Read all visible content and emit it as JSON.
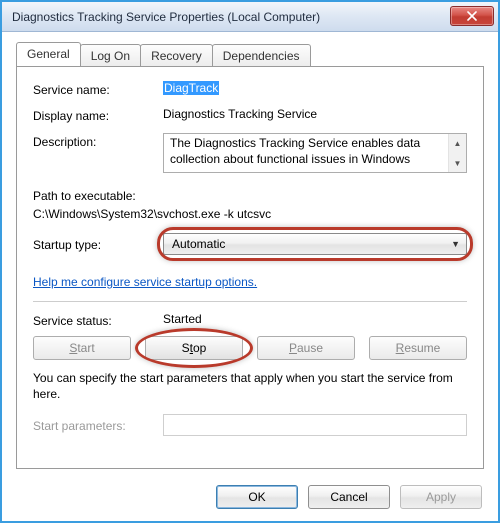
{
  "window": {
    "title": "Diagnostics Tracking Service Properties (Local Computer)"
  },
  "tabs": {
    "general": "General",
    "logon": "Log On",
    "recovery": "Recovery",
    "dependencies": "Dependencies"
  },
  "labels": {
    "service_name": "Service name:",
    "display_name": "Display name:",
    "description": "Description:",
    "path_label": "Path to executable:",
    "startup_type": "Startup type:",
    "service_status": "Service status:",
    "start_parameters": "Start parameters:"
  },
  "values": {
    "service_name": "DiagTrack",
    "display_name": "Diagnostics Tracking Service",
    "description": "The Diagnostics Tracking Service enables data collection about functional issues in Windows",
    "path": "C:\\Windows\\System32\\svchost.exe -k utcsvc",
    "startup_selected": "Automatic",
    "service_status": "Started",
    "start_parameters": ""
  },
  "help_link": "Help me configure service startup options.",
  "buttons": {
    "start": "Start",
    "stop": "Stop",
    "pause": "Pause",
    "resume": "Resume",
    "start_u": "S",
    "stop_u": "S",
    "pause_u": "P",
    "resume_u": "R"
  },
  "hint": "You can specify the start parameters that apply when you start the service from here.",
  "footer": {
    "ok": "OK",
    "cancel": "Cancel",
    "apply": "Apply"
  },
  "annotation": {
    "dropdown_ring_color": "#b93a2b",
    "stop_ring_color": "#b93a2b"
  }
}
